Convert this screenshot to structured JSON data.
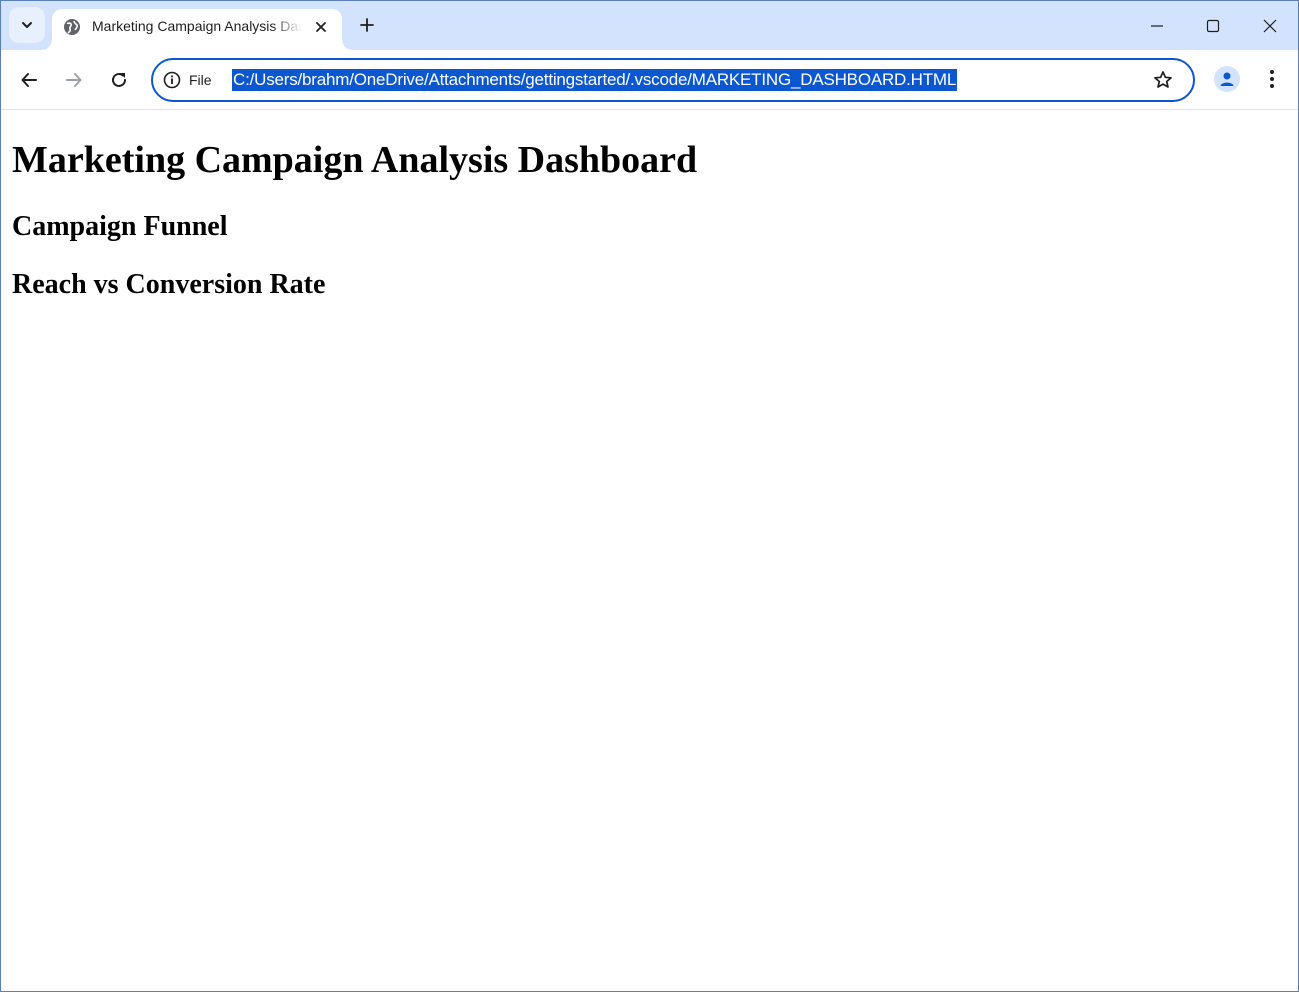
{
  "browser": {
    "tab": {
      "title": "Marketing Campaign Analysis Dashboard"
    },
    "toolbar": {
      "site_info_label": "File",
      "url": "C:/Users/brahm/OneDrive/Attachments/gettingstarted/.vscode/MARKETING_DASHBOARD.HTML"
    },
    "accent_color": "#0b57d0",
    "tabstrip_color": "#d3e3fd"
  },
  "page": {
    "heading": "Marketing Campaign Analysis Dashboard",
    "sections": [
      {
        "title": "Campaign Funnel"
      },
      {
        "title": "Reach vs Conversion Rate"
      }
    ]
  }
}
